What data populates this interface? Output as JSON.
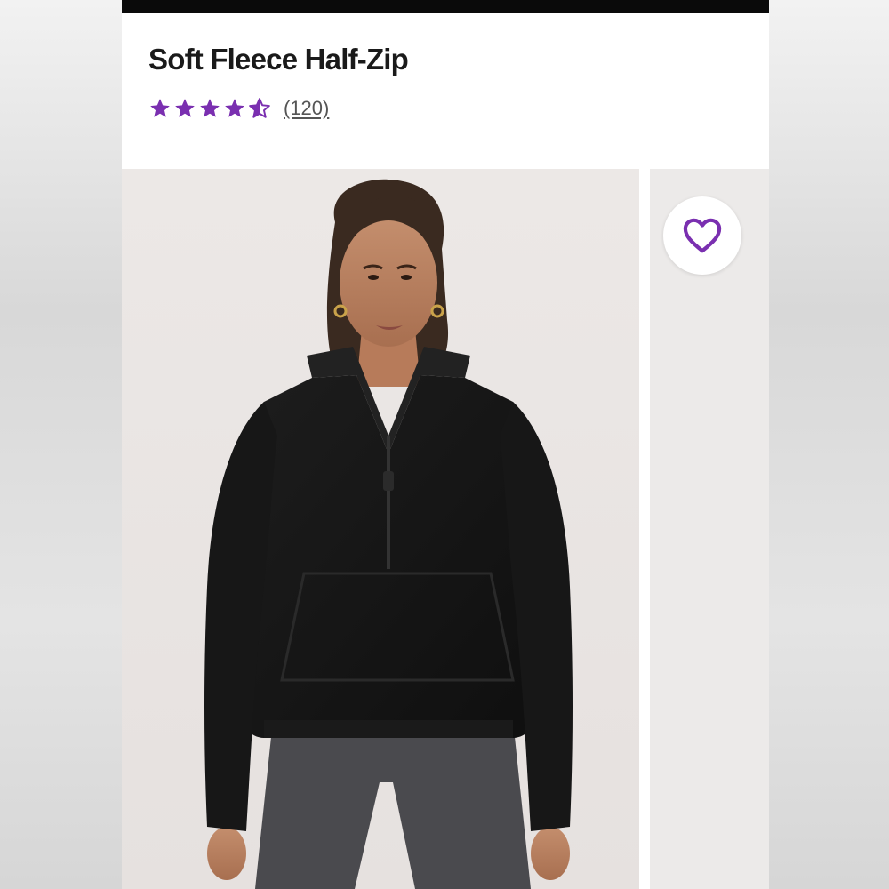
{
  "product": {
    "title": "Soft Fleece Half-Zip",
    "rating": 4.5,
    "rating_max": 5,
    "review_count_label": "(120)"
  },
  "colors": {
    "accent": "#7a2fb0",
    "topbar": "#0a0a0a",
    "garment": "#151515",
    "leggings": "#4a4a4e"
  },
  "icons": {
    "favorite": "heart-icon",
    "star_full": "star-icon",
    "star_half": "half-star-icon"
  }
}
